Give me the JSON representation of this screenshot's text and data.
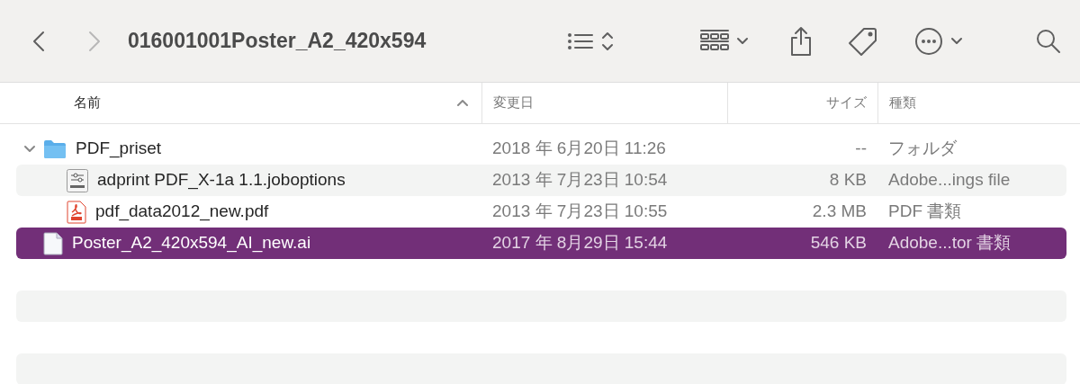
{
  "toolbar": {
    "back": {
      "disabled": false
    },
    "forward": {
      "disabled": true
    },
    "title": "016001001Poster_A2_420x594"
  },
  "columns": [
    {
      "label": "名前",
      "sorted": true
    },
    {
      "label": "変更日",
      "sorted": false
    },
    {
      "label": "サイズ",
      "sorted": false
    },
    {
      "label": "種類",
      "sorted": false
    }
  ],
  "files": [
    {
      "kind": "folder",
      "name": "PDF_priset",
      "date": "2018 年 6月20日 11:26",
      "size": "--",
      "file_kind": "フォルダ",
      "expanded": true,
      "selected": false,
      "children": [
        {
          "kind": "options",
          "name": "adprint PDF_X-1a 1.1.joboptions",
          "date": "2013 年 7月23日 10:54",
          "size": "8 KB",
          "file_kind": "Adobe...ings file",
          "selected": false
        },
        {
          "kind": "pdf",
          "name": "pdf_data2012_new.pdf",
          "date": "2013 年 7月23日 10:55",
          "size": "2.3 MB",
          "file_kind": "PDF 書類",
          "selected": false
        }
      ]
    },
    {
      "kind": "document",
      "name": "Poster_A2_420x594_AI_new.ai",
      "date": "2017 年 8月29日 15:44",
      "size": "546 KB",
      "file_kind": "Adobe...tor 書類",
      "selected": true
    }
  ]
}
